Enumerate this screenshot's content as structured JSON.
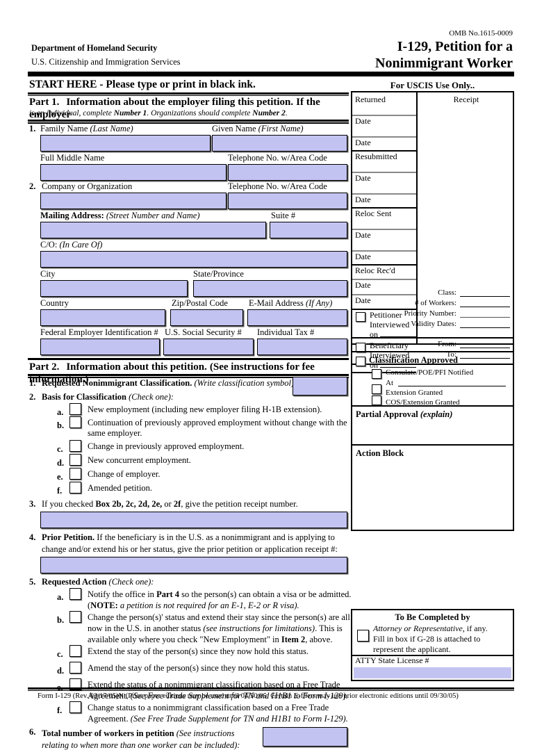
{
  "header": {
    "omb": "OMB No.1615-0009",
    "agency_line1": "Department of Homeland Security",
    "agency_line2": "U.S. Citizenship and Immigration Services",
    "title_line1": "I-129, Petition for a",
    "title_line2": "Nonimmigrant Worker",
    "start_here": "START HERE - Please type or print in black ink.",
    "uscis_only": "For USCIS Use Only.."
  },
  "part1": {
    "heading": "Part 1.",
    "title": "Information about the employer filing this petition.",
    "title_italic": "If the employer",
    "sub_a": "is an individual, complete ",
    "sub_b": "Number 1",
    "sub_c": ".  Organizations should complete ",
    "sub_d": "Number 2",
    "sub_e": ".",
    "item1_num": "1.",
    "label_family_name": "Family Name",
    "label_family_name_it": "(Last Name)",
    "label_given_name": "Given Name",
    "label_given_name_it": "(First Name)",
    "label_middle_name": "Full Middle Name",
    "label_telephone1": "Telephone No. w/Area Code",
    "item2_num": "2.",
    "label_company": "Company or Organization",
    "label_telephone2": "Telephone No. w/Area Code",
    "label_mailing": "Mailing Address:",
    "label_mailing_it": "(Street Number and Name)",
    "label_suite": "Suite #",
    "label_co": "C/O:",
    "label_co_it": "(In Care Of)",
    "label_city": "City",
    "label_state": "State/Province",
    "label_country": "Country",
    "label_zip": "Zip/Postal Code",
    "label_email": "E-Mail Address",
    "label_email_it": "(If Any)",
    "label_fein": "Federal Employer Identification #",
    "label_ssn": "U.S. Social Security #",
    "label_itin": "Individual Tax #",
    "values": {
      "family_name": "",
      "given_name": "",
      "middle_name": "",
      "telephone1": "",
      "company": "",
      "telephone2": "",
      "mailing_address": "",
      "suite": "",
      "co": "",
      "city": "",
      "state": "",
      "country": "",
      "zip": "",
      "email": "",
      "fein": "",
      "ssn": "",
      "itin": ""
    }
  },
  "part2": {
    "heading": "Part 2.",
    "title": "Information about this petition.",
    "title_italic": "(See instructions for fee information.)",
    "item1_num": "1.",
    "item1_label": "Requested Nonimmigrant Classification.",
    "item1_label_it": "(Write classification symbol):",
    "item1_value": "",
    "item2_num": "2.",
    "item2_label": "Basis for Classification",
    "item2_label_it": "(Check one):",
    "basis_options": [
      {
        "letter": "a.",
        "text": "New employment (including new employer filing H-1B extension).",
        "checked": false
      },
      {
        "letter": "b.",
        "text": "Continuation of previously approved employment without change with the same employer.",
        "checked": false
      },
      {
        "letter": "c.",
        "text": "Change in previously approved employment.",
        "checked": false
      },
      {
        "letter": "d.",
        "text": "New concurrent employment.",
        "checked": false
      },
      {
        "letter": "e.",
        "text": "Change of employer.",
        "checked": false
      },
      {
        "letter": "f.",
        "text": "Amended petition.",
        "checked": false
      }
    ],
    "item3_num": "3.",
    "item3_pre": "If you checked ",
    "item3_boxes": "Box 2b, 2c, 2d, 2e,",
    "item3_mid": " or ",
    "item3_box2f": "2f",
    "item3_post": ", give the petition receipt number.",
    "item3_value": "",
    "item4_num": "4.",
    "item4_label": "Prior Petition.",
    "item4_line1": " If the beneficiary is in the U.S. as a nonimmigrant and is applying to",
    "item4_line2": "change and/or extend his or her status, give the prior petition or application receipt #:",
    "item4_value": "",
    "item5_num": "5.",
    "item5_label": "Requested Action",
    "item5_label_it": "(Check one):",
    "action_options": [
      {
        "letter": "a.",
        "line1_a": "Notify the office in ",
        "line1_b": "Part 4",
        "line1_c": " so the person(s) can obtain a visa or be admitted.",
        "line2_a": "(",
        "line2_b": "NOTE:",
        "line2_c": " a petition is not required for an  E-1, E-2 or R visa).",
        "checked": false
      },
      {
        "letter": "b.",
        "line1": "Change the person(s)' status and extend their stay since the person(s) are all",
        "line2_a": "now in the U.S. in another status ",
        "line2_b": "(see instructions for limitations)",
        "line2_c": ".  This is",
        "line3_a": "available only where you  check \"New Employment\" in ",
        "line3_b": "Item 2",
        "line3_c": ", above.",
        "checked": false
      },
      {
        "letter": "c.",
        "line1": "Extend the stay of the person(s) since they now hold this status.",
        "checked": false
      },
      {
        "letter": "d.",
        "line1": "Amend the stay of the person(s) since they now hold this status.",
        "checked": false
      },
      {
        "letter": "e.",
        "line1": "Extend the status of a nonimmigrant classification based on a Free Trade",
        "line2_a": "Agreement.  ",
        "line2_b": "(See Free Trade Supplement for TN and H1B1 to Form I-129).",
        "checked": false
      },
      {
        "letter": "f.",
        "line1": "Change status to a nonimmigrant classification based on a Free Trade",
        "line2_a": "Agreement.  ",
        "line2_b": "(See Free Trade Supplement for TN and H1B1 to Form I-129).",
        "checked": false
      }
    ],
    "item6_num": "6.",
    "item6_line1": "Total number of workers in petition",
    "item6_line1_it": "(See instructions",
    "item6_line2_it": "relating to when more than one worker can be included):",
    "item6_value": ""
  },
  "uscis_box": {
    "returned_label": "Returned",
    "receipt_label": "Receipt",
    "date_label": "Date",
    "resubmitted_label": "Resubmitted",
    "reloc_sent_label": "Reloc Sent",
    "reloc_recd_label": "Reloc Rec'd",
    "petitioner_interviewed_l1": "Petitioner",
    "petitioner_interviewed_l2": "Interviewed",
    "petitioner_interviewed_l3": "on",
    "beneficiary_interviewed_l1": "Beneficiary",
    "beneficiary_interviewed_l2": "Interviewed",
    "beneficiary_interviewed_l3": "on",
    "class_label": "Class:",
    "workers_label": "# of Workers:",
    "priority_label": "Priority Number:",
    "validity_label": "Validity Dates:",
    "from_label": "From:",
    "to_label": "To:",
    "classification_approved": "Classification Approved",
    "consulate_notified": "Consulate/POE/PFI Notified",
    "at_label": "At",
    "extension_granted": "Extension Granted",
    "cos_extension_granted": "COS/Extension Granted",
    "partial_approval": "Partial Approval",
    "partial_approval_it": "(explain)",
    "action_block": "Action Block",
    "to_be_completed_by": "To Be Completed by",
    "attorney_it": "Attorney or Representative",
    "attorney_rest": ", if any.",
    "attorney_line2": "Fill in box if G-28 is attached to",
    "attorney_line3": "represent the applicant.",
    "atty_license": "ATTY State License #",
    "atty_license_value": ""
  },
  "footer": {
    "text": "Form I-129 (Rev. 03/17/05)N (Prior paper editions may be used until 04/30/05.  Certain E-filers may use prior electronic editions until 09/30/05)"
  },
  "colors": {
    "field_fill": "#c3c3f2",
    "border": "#000000"
  }
}
